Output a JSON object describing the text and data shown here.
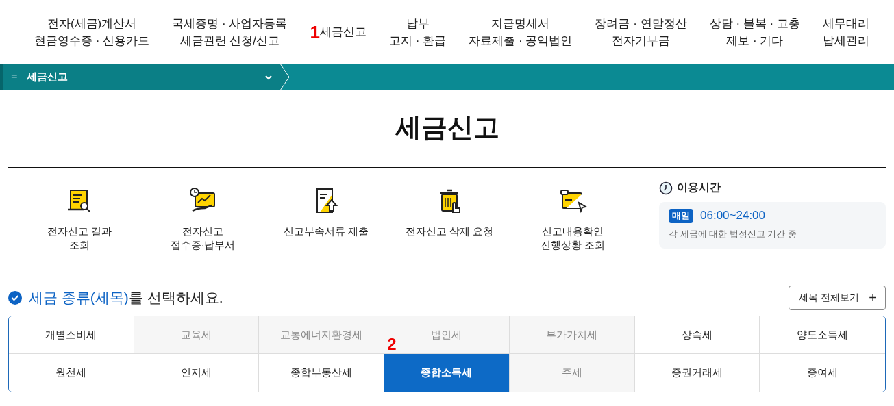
{
  "nav": [
    {
      "lines": [
        "전자(세금)계산서",
        "현금영수증 · 신용카드"
      ]
    },
    {
      "lines": [
        "국세증명 · 사업자등록",
        "세금관련 신청/신고"
      ]
    },
    {
      "lines": [
        "세금신고"
      ],
      "marker": "1"
    },
    {
      "lines": [
        "납부",
        "고지 · 환급"
      ]
    },
    {
      "lines": [
        "지급명세서",
        "자료제출 · 공익법인"
      ]
    },
    {
      "lines": [
        "장려금 · 연말정산",
        "전자기부금"
      ]
    },
    {
      "lines": [
        "상담 · 불복 · 고충",
        "제보 · 기타"
      ]
    },
    {
      "lines": [
        "세무대리",
        "납세관리"
      ]
    }
  ],
  "breadcrumb": {
    "menu_icon": "≡",
    "label": "세금신고"
  },
  "page_title": "세금신고",
  "quick_links": [
    {
      "kind": "scroll",
      "lines": [
        "전자신고 결과",
        "조회"
      ]
    },
    {
      "kind": "receipt",
      "lines": [
        "전자신고",
        "접수증·납부서"
      ]
    },
    {
      "kind": "document",
      "lines": [
        "신고부속서류 제출"
      ]
    },
    {
      "kind": "trash",
      "lines": [
        "전자신고 삭제 요청"
      ]
    },
    {
      "kind": "screen",
      "lines": [
        "신고내용확인",
        "진행상황 조회"
      ]
    }
  ],
  "hours": {
    "title": "이용시간",
    "badge": "매일",
    "time": "06:00~24:00",
    "note": "각 세금에 대한 법정신고 기간 중"
  },
  "section": {
    "heading_highlight": "세금 종류(세목)",
    "heading_rest": "를 선택하세요.",
    "view_all_button": "세목 전체보기",
    "plus": "+"
  },
  "taxes": [
    {
      "label": "개별소비세",
      "disabled": false,
      "selected": false
    },
    {
      "label": "교육세",
      "disabled": true,
      "selected": false
    },
    {
      "label": "교통에너지환경세",
      "disabled": true,
      "selected": false
    },
    {
      "label": "법인세",
      "disabled": true,
      "selected": false
    },
    {
      "label": "부가가치세",
      "disabled": true,
      "selected": false
    },
    {
      "label": "상속세",
      "disabled": false,
      "selected": false
    },
    {
      "label": "양도소득세",
      "disabled": false,
      "selected": false
    },
    {
      "label": "원천세",
      "disabled": false,
      "selected": false
    },
    {
      "label": "인지세",
      "disabled": false,
      "selected": false
    },
    {
      "label": "종합부동산세",
      "disabled": false,
      "selected": false
    },
    {
      "label": "종합소득세",
      "disabled": false,
      "selected": true,
      "marker": "2"
    },
    {
      "label": "주세",
      "disabled": true,
      "selected": false
    },
    {
      "label": "증권거래세",
      "disabled": false,
      "selected": false
    },
    {
      "label": "증여세",
      "disabled": false,
      "selected": false
    }
  ]
}
